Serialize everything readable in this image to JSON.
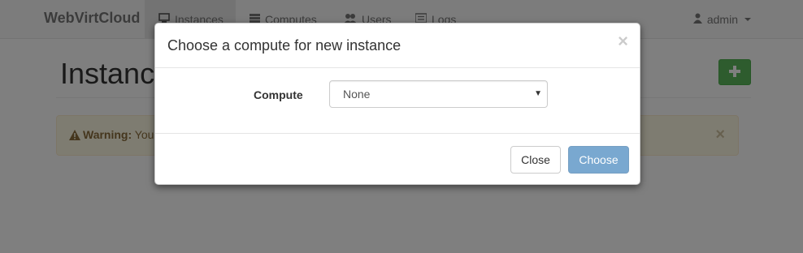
{
  "navbar": {
    "brand": "WebVirtCloud",
    "items": [
      {
        "label": "Instances",
        "icon": "monitor-icon"
      },
      {
        "label": "Computes",
        "icon": "server-icon"
      },
      {
        "label": "Users",
        "icon": "users-icon"
      },
      {
        "label": "Logs",
        "icon": "list-icon"
      }
    ],
    "user": {
      "label": "admin",
      "icon": "user-icon"
    }
  },
  "page": {
    "title": "Instances",
    "add_button_icon": "plus-icon"
  },
  "alert": {
    "strong": "Warning:",
    "text": " You"
  },
  "modal": {
    "title": "Choose a compute for new instance",
    "compute_label": "Compute",
    "compute_selected": "None",
    "close_button": "Close",
    "choose_button": "Choose"
  },
  "colors": {
    "success": "#5cb85c",
    "primary": "#337ab7",
    "warning_bg": "#fcf8e3",
    "warning_text": "#8a6d3b"
  }
}
